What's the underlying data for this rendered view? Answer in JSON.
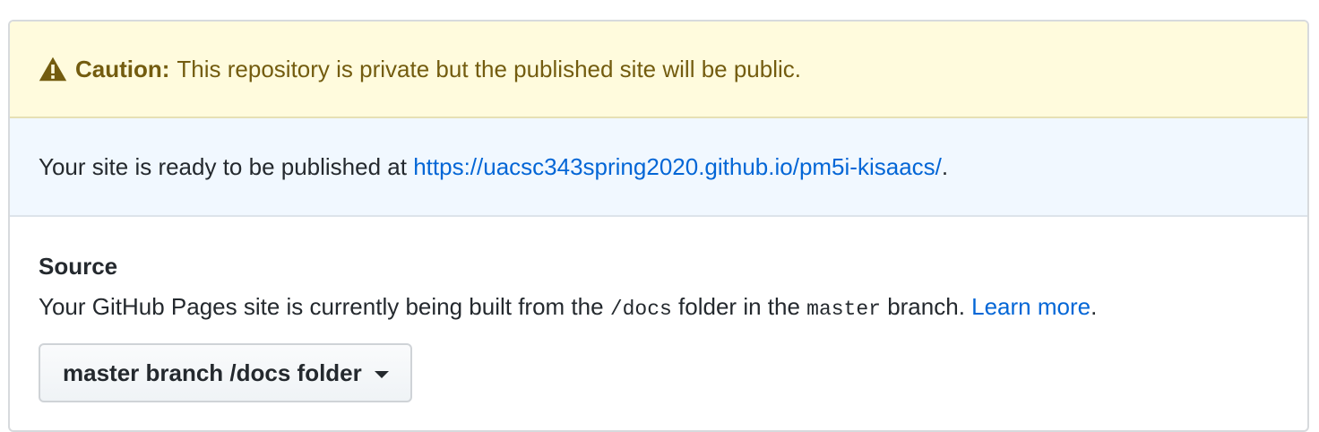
{
  "warning": {
    "icon": "alert-icon",
    "strong": "Caution:",
    "text": "This repository is private but the published site will be public."
  },
  "info": {
    "prefix": "Your site is ready to be published at ",
    "url": "https://uacsc343spring2020.github.io/pm5i-kisaacs/",
    "suffix": "."
  },
  "source": {
    "heading": "Source",
    "desc_part1": "Your GitHub Pages site is currently being built from the ",
    "folder_code": "/docs",
    "desc_part2": " folder in the ",
    "branch_code": "master",
    "desc_part3": " branch. ",
    "learn_more": "Learn more",
    "desc_end": "."
  },
  "select": {
    "label": "master branch /docs folder",
    "icon": "caret-down-icon"
  },
  "colors": {
    "warn_bg": "#fffbdd",
    "warn_text": "#735c0f",
    "info_bg": "#f1f8ff",
    "link": "#0366d6"
  }
}
